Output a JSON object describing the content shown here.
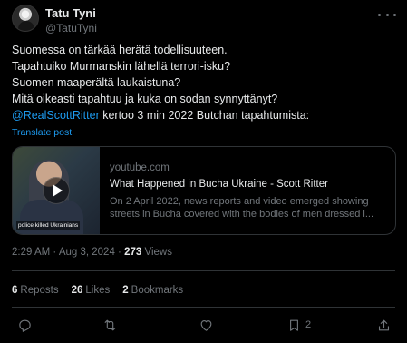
{
  "author": {
    "name": "Tatu Tyni",
    "handle": "@TatuTyni"
  },
  "post": {
    "lines": [
      "Suomessa on tärkää herätä todellisuuteen.",
      "Tapahtuiko Murmanskin lähellä terrori-isku?",
      "Suomen maaperältä laukaistuna?",
      "Mitä oikeasti tapahtuu ja kuka on sodan synnyttänyt?"
    ],
    "mention": "@RealScottRitter",
    "mention_tail": " kertoo 3 min 2022 Butchan tapahtumista:",
    "translate_label": "Translate post"
  },
  "card": {
    "domain": "youtube.com",
    "title": "What Happened in Bucha Ukraine - Scott Ritter",
    "description": "On 2 April 2022, news reports and video emerged showing streets in Bucha covered with the bodies of men dressed i...",
    "thumbnail_caption": "police killed Ukrainians"
  },
  "meta": {
    "time": "2:29 AM",
    "separator": "·",
    "date": "Aug 3, 2024",
    "views_count": "273",
    "views_label": "Views"
  },
  "stats": {
    "reposts_count": "6",
    "reposts_label": "Reposts",
    "likes_count": "26",
    "likes_label": "Likes",
    "bookmarks_count": "2",
    "bookmarks_label": "Bookmarks"
  },
  "actions": {
    "reply_icon": "reply-icon",
    "repost_icon": "repost-icon",
    "like_icon": "heart-icon",
    "bookmark_icon": "bookmark-icon",
    "bookmark_count": "2",
    "share_icon": "share-icon"
  },
  "colors": {
    "background": "#000000",
    "text": "#e7e9ea",
    "secondary": "#71767b",
    "link": "#1d9bf0",
    "border": "#2f3336"
  }
}
